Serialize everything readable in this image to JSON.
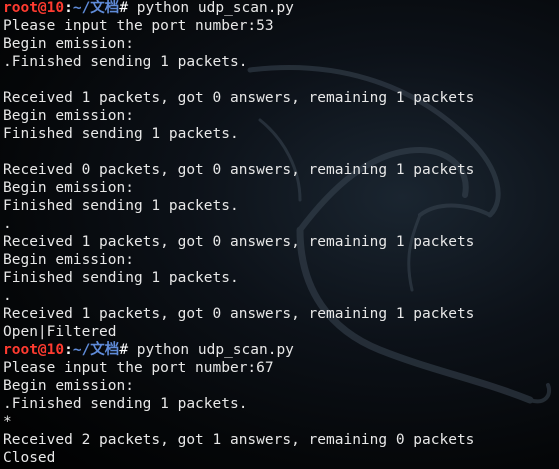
{
  "terminal": {
    "lines": [
      {
        "type": "prompt",
        "user": "root@10",
        "colon": ":",
        "path": "~/文档",
        "symbol": "#",
        "command": " python udp_scan.py"
      },
      {
        "type": "text",
        "text": "Please input the port number:53"
      },
      {
        "type": "text",
        "text": "Begin emission:"
      },
      {
        "type": "text",
        "text": ".Finished sending 1 packets."
      },
      {
        "type": "text",
        "text": ""
      },
      {
        "type": "text",
        "text": "Received 1 packets, got 0 answers, remaining 1 packets"
      },
      {
        "type": "text",
        "text": "Begin emission:"
      },
      {
        "type": "text",
        "text": "Finished sending 1 packets."
      },
      {
        "type": "text",
        "text": ""
      },
      {
        "type": "text",
        "text": "Received 0 packets, got 0 answers, remaining 1 packets"
      },
      {
        "type": "text",
        "text": "Begin emission:"
      },
      {
        "type": "text",
        "text": "Finished sending 1 packets."
      },
      {
        "type": "text",
        "text": "."
      },
      {
        "type": "text",
        "text": "Received 1 packets, got 0 answers, remaining 1 packets"
      },
      {
        "type": "text",
        "text": "Begin emission:"
      },
      {
        "type": "text",
        "text": "Finished sending 1 packets."
      },
      {
        "type": "text",
        "text": "."
      },
      {
        "type": "text",
        "text": "Received 1 packets, got 0 answers, remaining 1 packets"
      },
      {
        "type": "text",
        "text": "Open|Filtered"
      },
      {
        "type": "prompt",
        "user": "root@10",
        "colon": ":",
        "path": "~/文档",
        "symbol": "#",
        "command": " python udp_scan.py"
      },
      {
        "type": "text",
        "text": "Please input the port number:67"
      },
      {
        "type": "text",
        "text": "Begin emission:"
      },
      {
        "type": "text",
        "text": ".Finished sending 1 packets."
      },
      {
        "type": "text",
        "text": "*"
      },
      {
        "type": "text",
        "text": "Received 2 packets, got 1 answers, remaining 0 packets"
      },
      {
        "type": "text",
        "text": "Closed"
      },
      {
        "type": "cursor",
        "text": ""
      }
    ]
  },
  "colors": {
    "background": "#000000",
    "text": "#e8e8e8",
    "prompt_user": "#ff3b30",
    "prompt_path": "#5f8bd8"
  },
  "icons": {
    "wallpaper": "kali-dragon-logo"
  }
}
